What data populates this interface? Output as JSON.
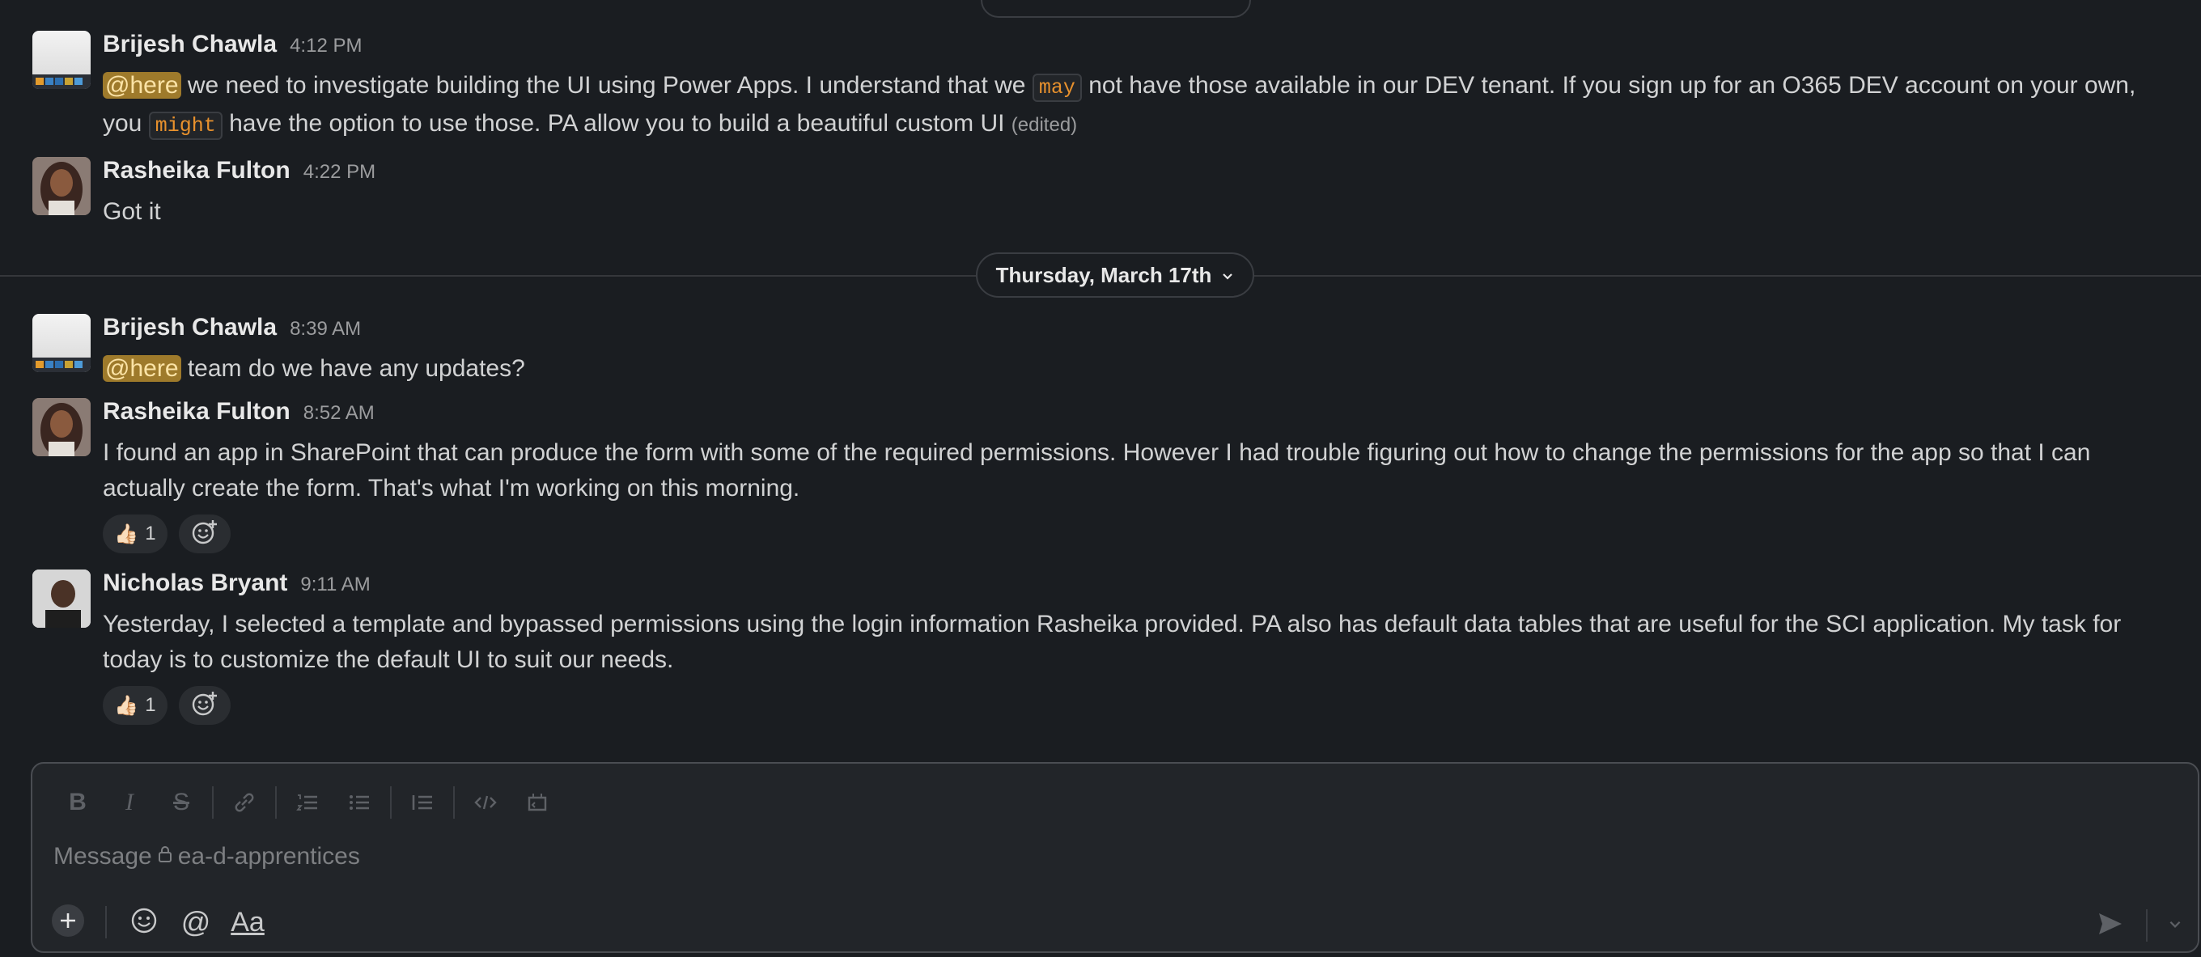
{
  "messages": [
    {
      "name": "Brijesh Chawla",
      "time": "4:12 PM",
      "parts": {
        "mention": "@here",
        "t1": " we need to investigate building the UI using Power Apps. I understand that we ",
        "code1": "may",
        "t2": " not have those available in our DEV tenant. If you sign up for an O365 DEV account on your own, you ",
        "code2": "might",
        "t3": " have the option to use those. PA allow you to build a beautiful custom UI ",
        "edited": "(edited)"
      }
    },
    {
      "name": "Rasheika Fulton",
      "time": "4:22 PM",
      "text": "Got it"
    },
    {
      "name": "Brijesh Chawla",
      "time": "8:39 AM",
      "parts": {
        "mention": "@here",
        "t1": " team do we have any updates?"
      }
    },
    {
      "name": "Rasheika Fulton",
      "time": "8:52 AM",
      "text": "I found an app in SharePoint  that can produce the form with some of the required permissions. However I had trouble figuring out how to change the permissions for the app so that I can actually create the form. That's what I'm working on this morning.",
      "reaction": {
        "emoji": "👍🏻",
        "count": "1"
      }
    },
    {
      "name": "Nicholas Bryant",
      "time": "9:11 AM",
      "text": "Yesterday, I selected a template and bypassed permissions using the login information Rasheika provided. PA also has default data tables that are useful for the SCI application. My task for today is to customize the default UI to suit our needs.",
      "reaction": {
        "emoji": "👍🏻",
        "count": "1"
      }
    }
  ],
  "date_divider": {
    "label": "Thursday, March 17th"
  },
  "composer": {
    "placeholder_prefix": "Message ",
    "channel": "ea-d-apprentices",
    "format_label": "Aa"
  },
  "colors": {
    "background": "#1a1d21",
    "mention_bg": "#9e7a2b",
    "code_text": "#e8912d"
  }
}
